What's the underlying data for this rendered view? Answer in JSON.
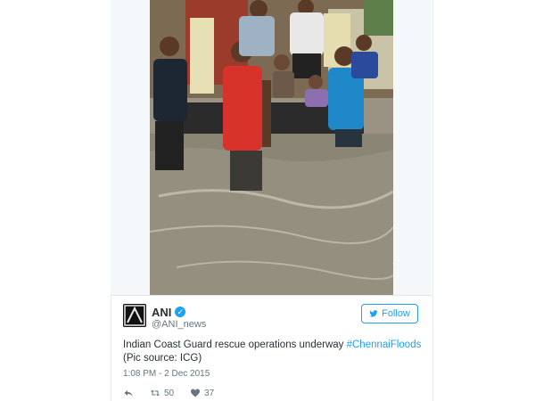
{
  "tweet": {
    "author_name": "ANI",
    "author_handle": "@ANI_news",
    "avatar_text": "ANI",
    "follow_label": "Follow",
    "text_prefix": "Indian Coast Guard rescue operations underway ",
    "hashtag": "#ChennaiFloods",
    "text_suffix": "(Pic source: ICG)",
    "timestamp": "1:08 PM - 2 Dec 2015",
    "retweet_count": "50",
    "like_count": "37"
  },
  "colors": {
    "accent": "#1da1f2",
    "text": "#292f33",
    "muted": "#66757f"
  },
  "icons": {
    "reply": "reply-icon",
    "retweet": "retweet-icon",
    "like": "heart-icon",
    "verified": "verified-badge-icon",
    "follow": "twitter-bird-icon"
  }
}
